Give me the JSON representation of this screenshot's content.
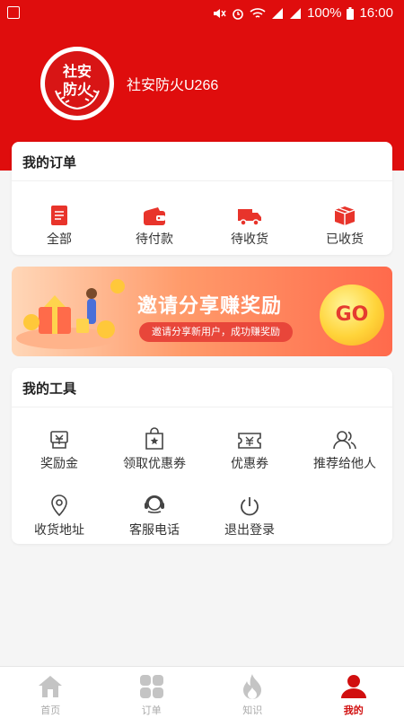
{
  "status_bar": {
    "battery": "100%",
    "time": "16:00"
  },
  "profile": {
    "avatar_text_top": "社安",
    "avatar_text_bottom": "防火",
    "username": "社安防火U266"
  },
  "orders": {
    "title": "我的订单",
    "items": [
      {
        "label": "全部",
        "icon": "document-icon"
      },
      {
        "label": "待付款",
        "icon": "wallet-icon"
      },
      {
        "label": "待收货",
        "icon": "truck-icon"
      },
      {
        "label": "已收货",
        "icon": "package-icon"
      }
    ]
  },
  "banner": {
    "title": "邀请分享赚奖励",
    "subtitle": "邀请分享新用户，成功赚奖励",
    "go": "GO"
  },
  "tools": {
    "title": "我的工具",
    "items": [
      {
        "label": "奖励金",
        "icon": "reward-card-icon"
      },
      {
        "label": "领取优惠券",
        "icon": "coupon-bag-icon"
      },
      {
        "label": "优惠券",
        "icon": "coupon-ticket-icon"
      },
      {
        "label": "推荐给他人",
        "icon": "users-icon"
      },
      {
        "label": "收货地址",
        "icon": "location-pin-icon"
      },
      {
        "label": "客服电话",
        "icon": "headset-icon"
      },
      {
        "label": "退出登录",
        "icon": "power-icon"
      }
    ]
  },
  "tabbar": {
    "items": [
      {
        "label": "首页",
        "icon": "home-icon",
        "active": false
      },
      {
        "label": "订单",
        "icon": "grid-icon",
        "active": false
      },
      {
        "label": "知识",
        "icon": "flame-icon",
        "active": false
      },
      {
        "label": "我的",
        "icon": "person-icon",
        "active": true
      }
    ]
  },
  "colors": {
    "brand_red": "#df0d0d",
    "background": "#f5f5f5",
    "tab_active": "#d10f0f",
    "tab_inactive": "#aaaaaa"
  }
}
